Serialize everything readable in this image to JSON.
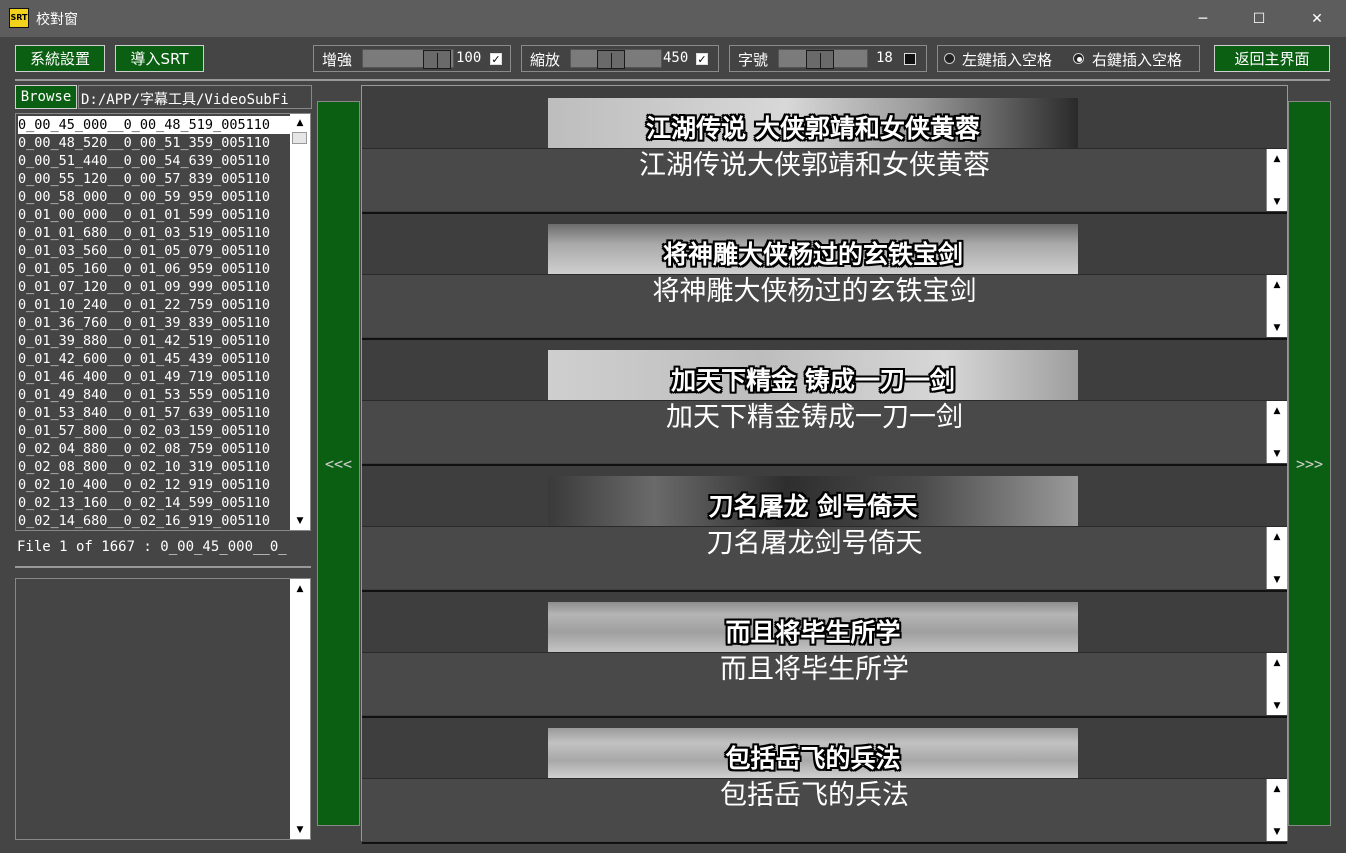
{
  "window": {
    "title": "校對窗",
    "app_icon": "SRT",
    "controls": {
      "minimize": "─",
      "maximize": "☐",
      "close": "✕"
    }
  },
  "toolbar": {
    "settings_label": "系統設置",
    "import_label": "導入SRT",
    "enhance": {
      "label": "增強",
      "value": "100",
      "checked": true
    },
    "zoom": {
      "label": "縮放",
      "value": "450",
      "checked": true
    },
    "font_size": {
      "label": "字號",
      "value": "18",
      "checked": false
    },
    "radio_left_label": "左鍵插入空格",
    "radio_right_label": "右鍵插入空格",
    "radio_selected": "right",
    "return_label": "返回主界面",
    "accent_color": "#0b5f12"
  },
  "left": {
    "browse_label": "Browse",
    "path": "D:/APP/字幕工具/VideoSubFi",
    "files": [
      "0_00_45_000__0_00_48_519_005110",
      "0_00_48_520__0_00_51_359_005110",
      "0_00_51_440__0_00_54_639_005110",
      "0_00_55_120__0_00_57_839_005110",
      "0_00_58_000__0_00_59_959_005110",
      "0_01_00_000__0_01_01_599_005110",
      "0_01_01_680__0_01_03_519_005110",
      "0_01_03_560__0_01_05_079_005110",
      "0_01_05_160__0_01_06_959_005110",
      "0_01_07_120__0_01_09_999_005110",
      "0_01_10_240__0_01_22_759_005110",
      "0_01_36_760__0_01_39_839_005110",
      "0_01_39_880__0_01_42_519_005110",
      "0_01_42_600__0_01_45_439_005110",
      "0_01_46_400__0_01_49_719_005110",
      "0_01_49_840__0_01_53_559_005110",
      "0_01_53_840__0_01_57_639_005110",
      "0_01_57_800__0_02_03_159_005110",
      "0_02_04_880__0_02_08_759_005110",
      "0_02_08_800__0_02_10_319_005110",
      "0_02_10_400__0_02_12_919_005110",
      "0_02_13_160__0_02_14_599_005110",
      "0_02_14_680__0_02_16_919_005110"
    ],
    "selected_index": 0,
    "status": "File 1 of 1667 :  0_00_45_000__0_"
  },
  "nav": {
    "prev_label": "<<<",
    "next_label": ">>>"
  },
  "subtitles": [
    {
      "image_text": "江湖传说  大侠郭靖和女侠黄蓉",
      "edit_text": "江湖传说大侠郭靖和女侠黄蓉"
    },
    {
      "image_text": "将神雕大侠杨过的玄铁宝剑",
      "edit_text": "将神雕大侠杨过的玄铁宝剑"
    },
    {
      "image_text": "加天下精金  铸成一刀一剑",
      "edit_text": "加天下精金铸成一刀一剑"
    },
    {
      "image_text": "刀名屠龙  剑号倚天",
      "edit_text": "刀名屠龙剑号倚天"
    },
    {
      "image_text": "而且将毕生所学",
      "edit_text": "而且将毕生所学"
    },
    {
      "image_text": "包括岳飞的兵法",
      "edit_text": "包括岳飞的兵法"
    }
  ]
}
